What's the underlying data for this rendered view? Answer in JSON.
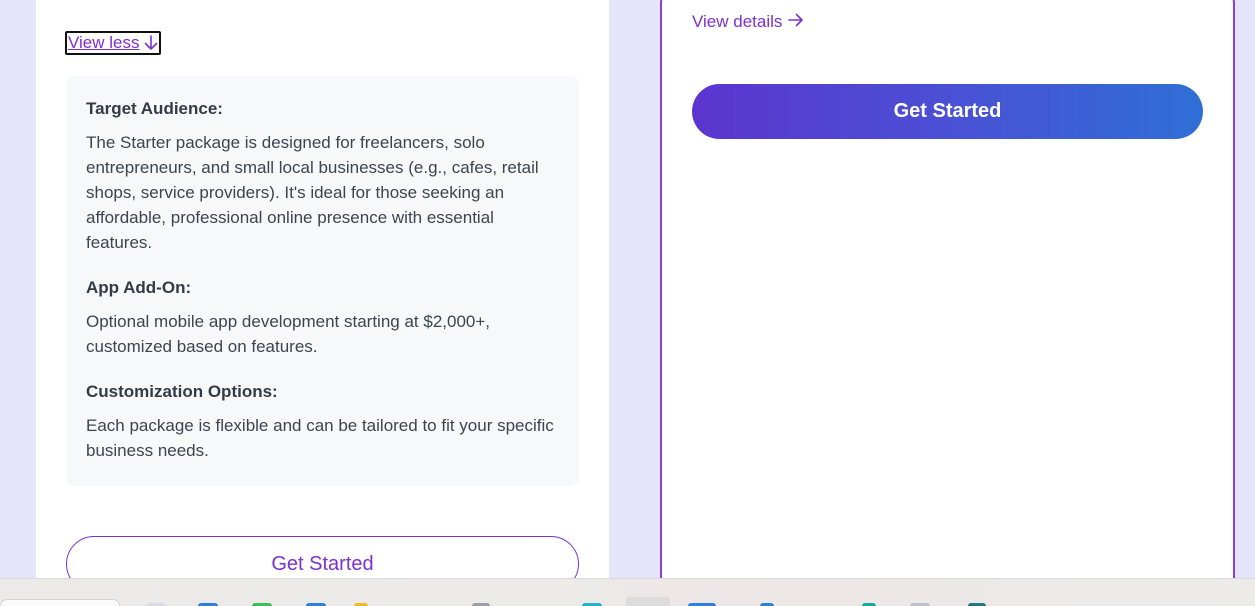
{
  "left_card": {
    "view_less_label": "View less",
    "sections": [
      {
        "heading": "Target Audience:",
        "body": "The Starter package is designed for freelancers, solo entrepreneurs, and small local businesses (e.g., cafes, retail shops, service providers). It's ideal for those seeking an affordable, professional online presence with essential features."
      },
      {
        "heading": "App Add-On:",
        "body": "Optional mobile app development starting at $2,000+, customized based on features."
      },
      {
        "heading": "Customization Options:",
        "body": "Each package is flexible and can be tailored to fit your specific business needs."
      }
    ],
    "cta_label": "Get Started"
  },
  "right_card": {
    "view_details_label": "View details",
    "cta_label": "Get Started"
  },
  "colors": {
    "accent": "#7e2fd0",
    "gradient_start": "#5b35cf",
    "gradient_end": "#2f6fd6",
    "page_bg": "#e4e4fa"
  },
  "icons": {
    "view_less": "arrow-down-icon",
    "view_details": "arrow-right-icon"
  }
}
